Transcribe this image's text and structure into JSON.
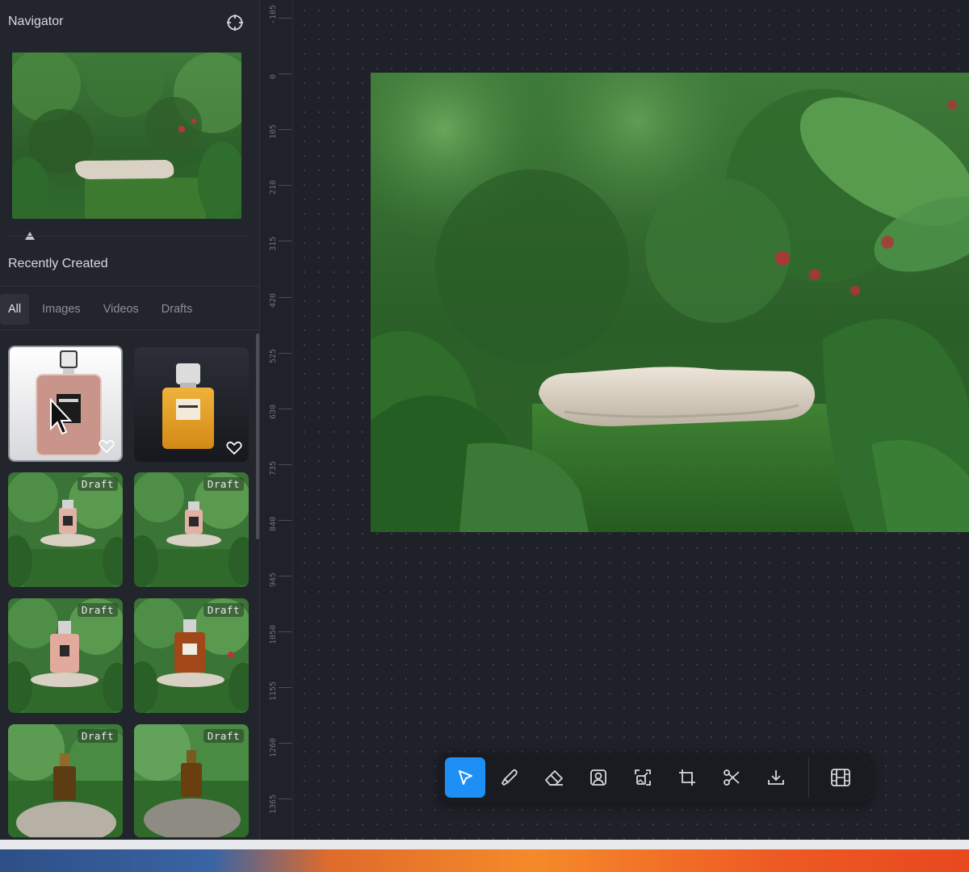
{
  "navigator": {
    "title": "Navigator",
    "target_icon": "crosshair-icon",
    "collapse_icon": "triangle-up-icon"
  },
  "recent": {
    "title": "Recently Created",
    "tabs": [
      {
        "label": "All",
        "active": true
      },
      {
        "label": "Images",
        "active": false
      },
      {
        "label": "Videos",
        "active": false
      },
      {
        "label": "Drafts",
        "active": false
      }
    ],
    "items": [
      {
        "type": "image",
        "bottle": "pink-bottle",
        "favorite_icon": "heart-icon",
        "selected": true
      },
      {
        "type": "image",
        "bottle": "amber-bottle",
        "favorite_icon": "heart-icon",
        "selected": false
      },
      {
        "type": "draft",
        "badge": "Draft"
      },
      {
        "type": "draft",
        "badge": "Draft"
      },
      {
        "type": "draft",
        "badge": "Draft"
      },
      {
        "type": "draft",
        "badge": "Draft"
      },
      {
        "type": "draft",
        "badge": "Draft"
      },
      {
        "type": "draft",
        "badge": "Draft"
      }
    ]
  },
  "ruler": {
    "ticks": [
      "-105",
      "0",
      "105",
      "210",
      "315",
      "420",
      "525",
      "630",
      "735",
      "840",
      "945",
      "1050",
      "1155",
      "1260",
      "1365"
    ]
  },
  "toolbar": {
    "tools": [
      {
        "name": "select-tool",
        "icon": "pointer-icon",
        "active": true
      },
      {
        "name": "brush-tool",
        "icon": "brush-icon",
        "active": false
      },
      {
        "name": "eraser-tool",
        "icon": "eraser-icon",
        "active": false
      },
      {
        "name": "portrait-tool",
        "icon": "portrait-icon",
        "active": false
      },
      {
        "name": "expand-tool",
        "icon": "image-expand-icon",
        "active": false
      },
      {
        "name": "crop-tool",
        "icon": "crop-icon",
        "active": false
      },
      {
        "name": "cut-tool",
        "icon": "scissors-icon",
        "active": false
      },
      {
        "name": "download-tool",
        "icon": "download-icon",
        "active": false
      },
      {
        "name": "video-tool",
        "icon": "film-icon",
        "active": false
      }
    ]
  },
  "colors": {
    "accent": "#1e8ff5",
    "panel_bg": "#23252d",
    "canvas_bg": "#1f2129"
  }
}
